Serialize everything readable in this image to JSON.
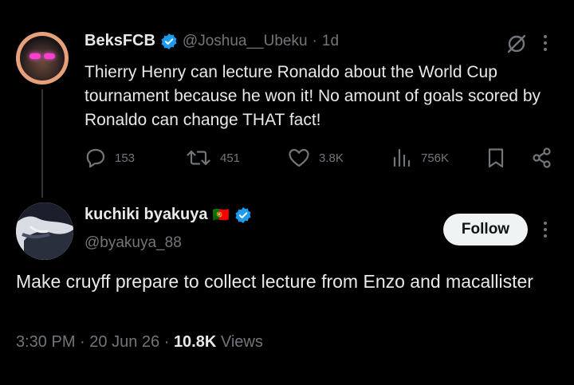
{
  "quoted_tweet": {
    "author_name": "BeksFCB",
    "handle": "@Joshua__Ubeku",
    "separator": "·",
    "time": "1d",
    "text": "Thierry Henry can lecture Ronaldo about the World Cup tournament because he won it! No amount of goals scored by Ronaldo can change THAT fact!",
    "actions": {
      "replies": "153",
      "reposts": "451",
      "likes": "3.8K",
      "views": "756K"
    }
  },
  "reply": {
    "author_name": "kuchiki byakuya",
    "flag": "🇵🇹",
    "handle": "@byakuya_88",
    "follow_label": "Follow",
    "text": "Make cruyff prepare to collect lecture from Enzo and macallister",
    "time": "3:30 PM",
    "dot1": "·",
    "date": "20 Jun 26",
    "dot2": "·",
    "views_count": "10.8K",
    "views_label": "Views"
  },
  "colors": {
    "background": "#000000",
    "text": "#e7e9ea",
    "muted": "#71767b",
    "verified": "#1d9bf0",
    "follow_bg": "#eff3f4"
  }
}
